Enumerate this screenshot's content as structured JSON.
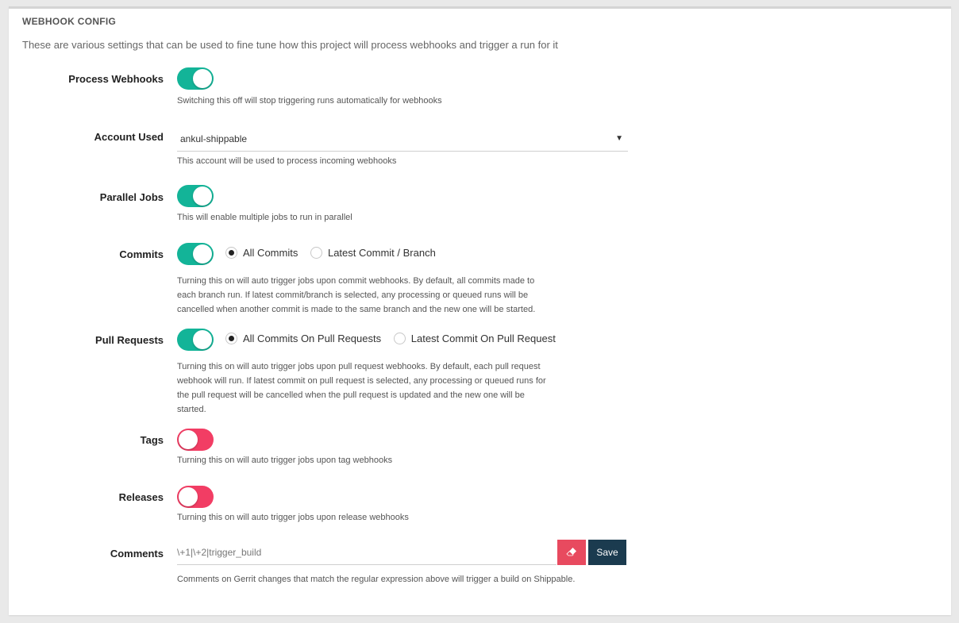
{
  "panel": {
    "title": "WEBHOOK CONFIG",
    "description": "These are various settings that can be used to fine tune how this project will process webhooks and trigger a run for it"
  },
  "process_webhooks": {
    "label": "Process Webhooks",
    "state": "on",
    "help": "Switching this off will stop triggering runs automatically for webhooks"
  },
  "account_used": {
    "label": "Account Used",
    "value": "ankul-shippable",
    "caret": "▼",
    "help": "This account will be used to process incoming webhooks"
  },
  "parallel_jobs": {
    "label": "Parallel Jobs",
    "state": "on",
    "help": "This will enable multiple jobs to run in parallel"
  },
  "commits": {
    "label": "Commits",
    "state": "on",
    "options": [
      "All Commits",
      "Latest Commit / Branch"
    ],
    "selected": "All Commits",
    "help": [
      "Turning this on will auto trigger jobs upon commit webhooks. By default, all commits made to",
      "each branch run. If latest commit/branch is selected, any processing or queued runs will be",
      "cancelled when another commit is made to the same branch and the new one will be started."
    ]
  },
  "pull_requests": {
    "label": "Pull Requests",
    "state": "on",
    "options": [
      "All Commits On Pull Requests",
      "Latest Commit On Pull Request"
    ],
    "selected": "All Commits On Pull Requests",
    "help": [
      "Turning this on will auto trigger jobs upon pull request webhooks. By default, each pull request",
      "webhook will run. If latest commit on pull request is selected, any processing or queued runs for",
      "the pull request will be cancelled when the pull request is updated and the new one will be",
      "started."
    ]
  },
  "tags": {
    "label": "Tags",
    "state": "off",
    "help": "Turning this on will auto trigger jobs upon tag webhooks"
  },
  "releases": {
    "label": "Releases",
    "state": "off",
    "help": "Turning this on will auto trigger jobs upon release webhooks"
  },
  "comments": {
    "label": "Comments",
    "value": "\\+1|\\+2|trigger_build",
    "save_label": "Save",
    "help": "Comments on Gerrit changes that match the regular expression above will trigger a build on Shippable."
  },
  "colors": {
    "toggle_on": "#13b498",
    "toggle_off": "#f23d64",
    "clear_button": "#e84a5f",
    "save_button": "#1b3b4f"
  },
  "icons": {
    "clear": "eraser-icon"
  }
}
